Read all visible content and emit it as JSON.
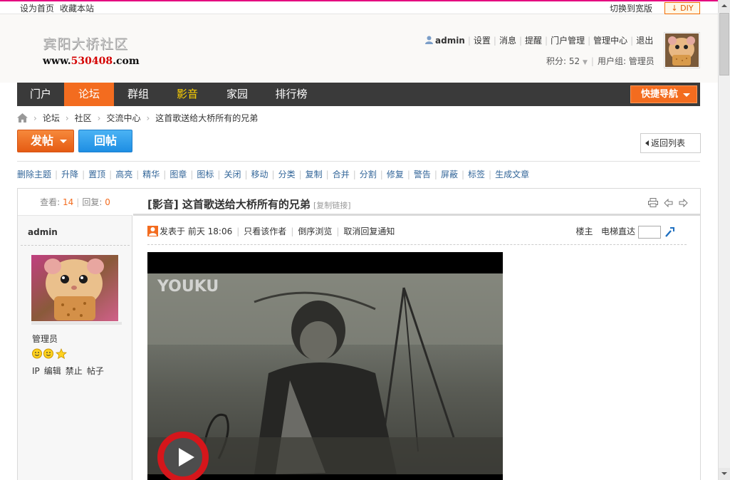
{
  "topbar": {
    "set_homepage": "设为首页",
    "bookmark": "收藏本站",
    "switch_wide": "切换到宽版",
    "diy_label": "DIY"
  },
  "header": {
    "logo_text": "宾阳大桥社区",
    "logo_url_prefix": "www.",
    "logo_url_number": "530408",
    "logo_url_suffix": ".com",
    "user": {
      "username": "admin",
      "links": [
        "设置",
        "消息",
        "提醒",
        "门户管理",
        "管理中心",
        "退出"
      ],
      "points": "积分: 52",
      "usergroup": "用户组: 管理员"
    }
  },
  "nav": {
    "items": [
      {
        "label": "门户"
      },
      {
        "label": "论坛"
      },
      {
        "label": "群组"
      },
      {
        "label": "影音"
      },
      {
        "label": "家园"
      },
      {
        "label": "排行榜"
      }
    ],
    "active": "论坛",
    "quick_nav": "快捷导航"
  },
  "breadcrumb": [
    "论坛",
    "社区",
    "交流中心",
    "这首歌送给大桥所有的兄弟"
  ],
  "actions": {
    "post": "发帖",
    "reply": "回帖",
    "back_to_list": "返回列表"
  },
  "mod_tools": [
    "删除主题",
    "升降",
    "置顶",
    "高亮",
    "精华",
    "图章",
    "图标",
    "关闭",
    "移动",
    "分类",
    "复制",
    "合并",
    "分割",
    "修复",
    "警告",
    "屏蔽",
    "标签",
    "生成文章"
  ],
  "thread": {
    "views_label": "查看:",
    "views": "14",
    "replies_label": "回复:",
    "replies": "0",
    "title": "[影音] 这首歌送给大桥所有的兄弟",
    "copy_link": "[复制链接]"
  },
  "author": {
    "name": "admin",
    "group": "管理员",
    "actions": [
      "IP",
      "编辑",
      "禁止",
      "帖子"
    ]
  },
  "post_meta": {
    "posted_prefix": "发表于",
    "posted_time": "前天 18:06",
    "only_author": "只看该作者",
    "reverse_order": "倒序浏览",
    "cancel_notify": "取消回复通知",
    "floor": "楼主",
    "jump_label": "电梯直达"
  },
  "video": {
    "watermark": "YOUKU"
  },
  "colors": {
    "nav_bg": "#3a3a3a",
    "accent_orange": "#f36c1f",
    "reply_blue": "#1e8ee3",
    "link_blue": "#336699",
    "highlight_yellow": "#ffd200",
    "top_border": "#e4007f"
  }
}
